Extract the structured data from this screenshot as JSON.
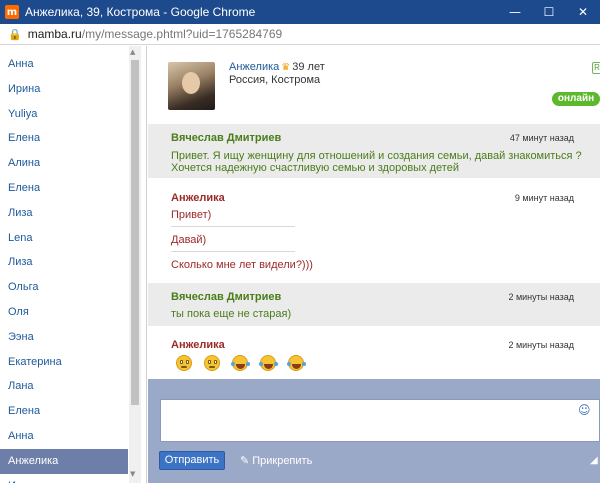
{
  "window": {
    "title": "Анжелика, 39, Кострома - Google Chrome",
    "favicon_letter": "m",
    "favicon_color": "#ff6a00",
    "titlebar_color": "#1d4a8c"
  },
  "address": {
    "host": "mamba.ru",
    "path": "/my/message.phtml?uid=1765284769"
  },
  "contacts": [
    {
      "name": "Анна",
      "active": false
    },
    {
      "name": "Ирина",
      "active": false
    },
    {
      "name": "Yuliya",
      "active": false
    },
    {
      "name": "Елена",
      "active": false
    },
    {
      "name": "Алина",
      "active": false
    },
    {
      "name": "Елена",
      "active": false
    },
    {
      "name": "Лиза",
      "active": false
    },
    {
      "name": "Lena",
      "active": false
    },
    {
      "name": "Лиза",
      "active": false
    },
    {
      "name": "Ольга",
      "active": false
    },
    {
      "name": "Оля",
      "active": false
    },
    {
      "name": "Ээна",
      "active": false
    },
    {
      "name": "Екатерина",
      "active": false
    },
    {
      "name": "Лана",
      "active": false
    },
    {
      "name": "Елена",
      "active": false
    },
    {
      "name": "Анна",
      "active": false
    },
    {
      "name": "Анжелика",
      "active": true
    },
    {
      "name": "Ирина",
      "active": false
    }
  ],
  "profile": {
    "name": "Анжелика",
    "age": "39 лет",
    "location": "Россия, Кострома",
    "status": "онлайн",
    "badge": "R"
  },
  "messages": [
    {
      "sender": "Вячеслав Дмитриев",
      "time": "47 минут назад",
      "lines": [
        "Привет. Я ищу женщину для отношений и создания семьи, давай знакомиться ?",
        "Хочется надежную счастливую семью и здоровых детей"
      ]
    },
    {
      "sender": "Анжелика",
      "time": "9 минут назад",
      "lines": [
        "Привет)",
        "Давай)",
        "Сколько мне лет видели?)))"
      ]
    },
    {
      "sender": "Вячеслав Дмитриев",
      "time": "2 минуты назад",
      "lines": [
        "ты пока еще не старая)"
      ]
    },
    {
      "sender": "Анжелика",
      "time": "2 минуты назад",
      "emoji": [
        "rolling-eyes-emoji",
        "rolling-eyes-emoji",
        "laughing-emoji",
        "laughing-emoji",
        "laughing-emoji"
      ]
    }
  ],
  "compose": {
    "send_label": "Отправить",
    "attach_label": "Прикрепить"
  },
  "colors": {
    "sender_green": "#4a7d1a",
    "sender_red": "#9b2a2a",
    "online_green": "#5db82c",
    "active_contact": "#6d7ea8"
  }
}
